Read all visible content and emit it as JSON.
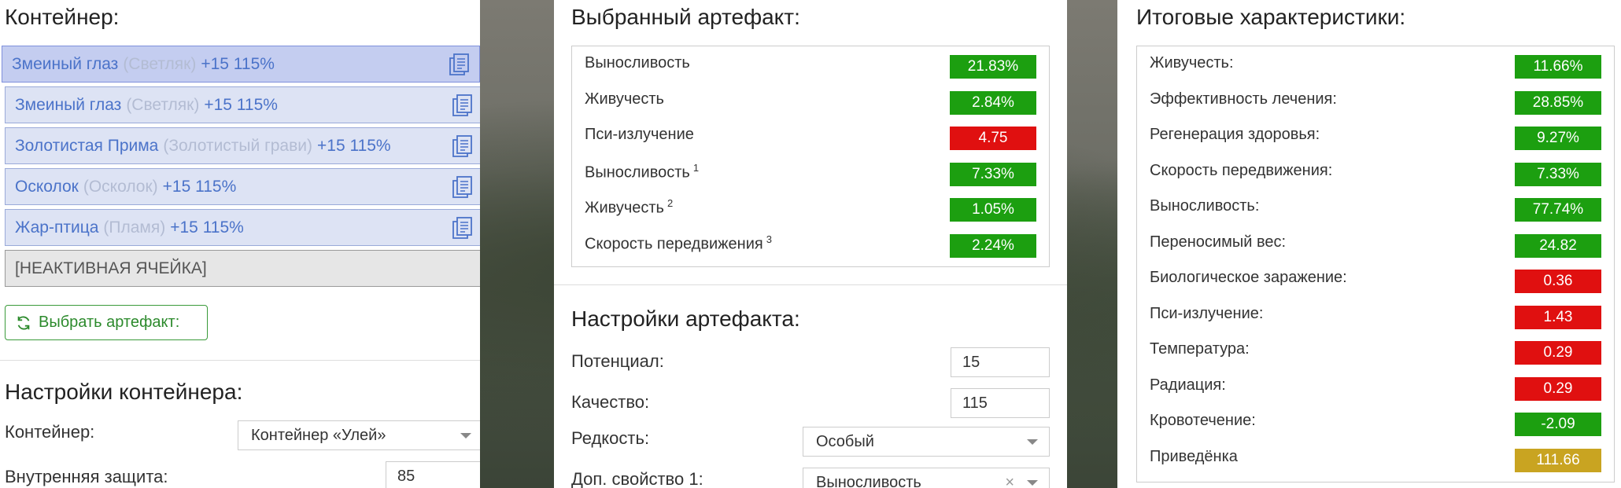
{
  "container_panel": {
    "title": "Контейнер:",
    "slots": [
      {
        "name": "Змеиный глаз",
        "type": "(Светляк)",
        "bonus": "+15 115%"
      },
      {
        "name": "Змеиный глаз",
        "type": "(Светляк)",
        "bonus": "+15 115%"
      },
      {
        "name": "Золотистая Прима",
        "type": "(Золотистый грави)",
        "bonus": "+15 115%"
      },
      {
        "name": "Осколок",
        "type": "(Осколок)",
        "bonus": "+15 115%"
      },
      {
        "name": "Жар-птица",
        "type": "(Пламя)",
        "bonus": "+15 115%"
      }
    ],
    "inactive_slot": "[НЕАКТИВНАЯ ЯЧЕЙКА]",
    "select_button": "Выбрать артефакт:",
    "settings_title": "Настройки контейнера:",
    "container_label": "Контейнер:",
    "container_value": "Контейнер «Улей»",
    "protection_label": "Внутренняя защита:",
    "protection_value": "85"
  },
  "artifact_panel": {
    "title": "Выбранный артефакт:",
    "stats": [
      {
        "name": "Выносливость",
        "sup": "",
        "value": "21.83%",
        "color": "green"
      },
      {
        "name": "Живучесть",
        "sup": "",
        "value": "2.84%",
        "color": "green"
      },
      {
        "name": "Пси-излучение",
        "sup": "",
        "value": "4.75",
        "color": "red"
      },
      {
        "name": "Выносливость",
        "sup": "1",
        "value": "7.33%",
        "color": "green"
      },
      {
        "name": "Живучесть",
        "sup": "2",
        "value": "1.05%",
        "color": "green"
      },
      {
        "name": "Скорость передвижения",
        "sup": "3",
        "value": "2.24%",
        "color": "green"
      }
    ],
    "settings_title": "Настройки артефакта:",
    "potential_label": "Потенциал:",
    "potential_value": "15",
    "quality_label": "Качество:",
    "quality_value": "115",
    "rarity_label": "Редкость:",
    "rarity_value": "Особый",
    "extra1_label": "Доп. свойство 1:",
    "extra1_value": "Выносливость"
  },
  "totals_panel": {
    "title": "Итоговые характеристики:",
    "stats": [
      {
        "name": "Живучесть:",
        "value": "11.66%",
        "color": "green"
      },
      {
        "name": "Эффективность лечения:",
        "value": "28.85%",
        "color": "green"
      },
      {
        "name": "Регенерация здоровья:",
        "value": "9.27%",
        "color": "green"
      },
      {
        "name": "Скорость передвижения:",
        "value": "7.33%",
        "color": "green"
      },
      {
        "name": "Выносливость:",
        "value": "77.74%",
        "color": "green"
      },
      {
        "name": "Переносимый вес:",
        "value": "24.82",
        "color": "green"
      },
      {
        "name": "Биологическое заражение:",
        "value": "0.36",
        "color": "red"
      },
      {
        "name": "Пси-излучение:",
        "value": "1.43",
        "color": "red"
      },
      {
        "name": "Температура:",
        "value": "0.29",
        "color": "red"
      },
      {
        "name": "Радиация:",
        "value": "0.29",
        "color": "red"
      },
      {
        "name": "Кровотечение:",
        "value": "-2.09",
        "color": "green"
      },
      {
        "name": "Приведёнка",
        "value": "111.66",
        "color": "gold"
      }
    ]
  },
  "colors": {
    "green": "#1c9f10",
    "red": "#e01010",
    "gold": "#c9a421",
    "slot_text": "#4b73c9"
  },
  "icons": {
    "copy": "copy-icon",
    "refresh": "refresh-icon",
    "caret": "chevron-down-icon",
    "clear": "clear-icon"
  }
}
